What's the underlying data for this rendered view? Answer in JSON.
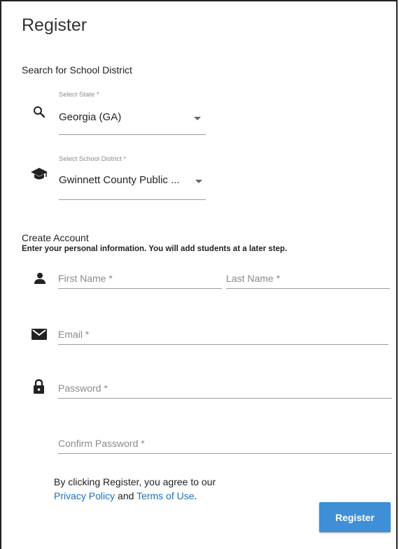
{
  "page": {
    "title": "Register"
  },
  "district_search": {
    "heading": "Search for School District",
    "state": {
      "label": "Select State *",
      "value": "Georgia (GA)"
    },
    "district": {
      "label": "Select School District *",
      "value": "Gwinnett County Public ..."
    }
  },
  "account": {
    "heading": "Create Account",
    "note": "Enter your personal information.  You will add students at a later step.",
    "first_name": {
      "placeholder": "First Name *"
    },
    "last_name": {
      "placeholder": "Last Name *"
    },
    "email": {
      "placeholder": "Email *"
    },
    "password": {
      "placeholder": "Password *"
    },
    "confirm_password": {
      "placeholder": "Confirm Password *"
    }
  },
  "legal": {
    "prefix": "By clicking Register, you agree to our",
    "privacy": "Privacy Policy",
    "and": "and",
    "terms": "Terms of Use",
    "period": "."
  },
  "actions": {
    "register_label": "Register"
  },
  "icons": [
    "search-icon",
    "graduation-cap-icon",
    "person-icon",
    "envelope-icon",
    "lock-icon"
  ],
  "colors": {
    "accent": "#3e8fd8",
    "link": "#1e6fb8"
  }
}
